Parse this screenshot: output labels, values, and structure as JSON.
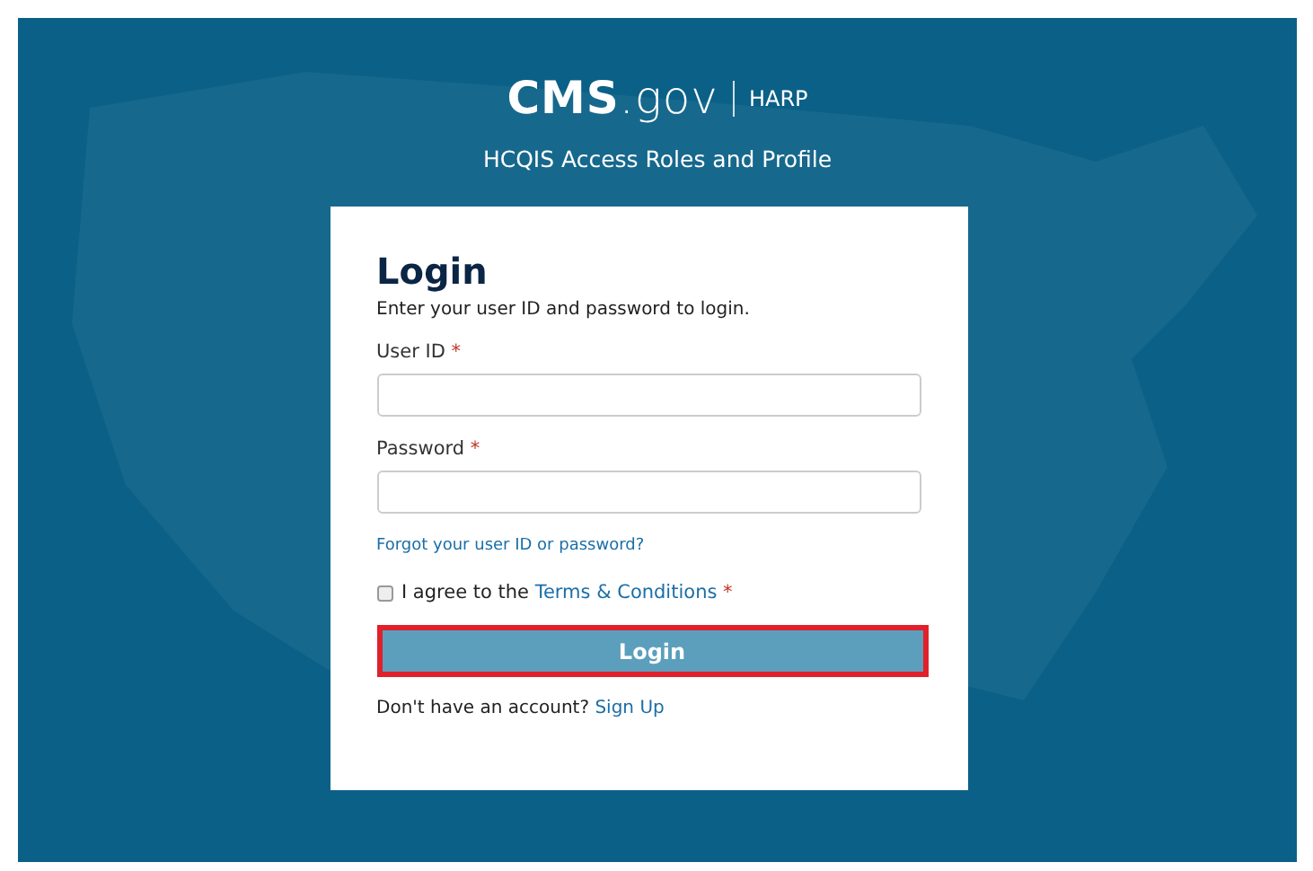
{
  "header": {
    "logo": "**CMS**.gov",
    "product": "HARP",
    "subtitle": "HCQIS Access Roles and Profile"
  },
  "login": {
    "title": "Login",
    "intro": "Enter your user ID and password to login.",
    "fields": [
      {
        "label": "User ID",
        "required_mark": "*"
      },
      {
        "label": "Password",
        "required_mark": "*"
      }
    ],
    "forgot_link": "Forgot your user ID or password?",
    "terms": {
      "checked": false,
      "text": "I agree to the",
      "link": "Terms & Conditions",
      "required_mark": "*"
    },
    "button": {
      "label": "Login",
      "highlighted": true
    },
    "signup": {
      "text": "Don't have an account?",
      "link": "Sign Up"
    }
  }
}
